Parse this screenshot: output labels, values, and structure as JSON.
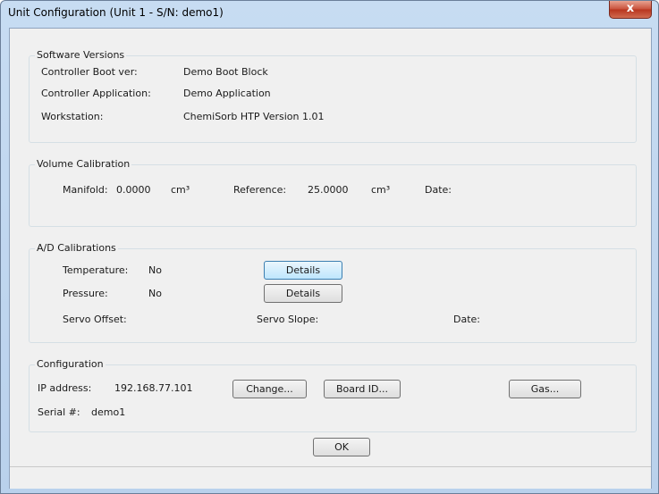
{
  "window": {
    "title": "Unit Configuration (Unit 1 - S/N: demo1)",
    "close_glyph": "x"
  },
  "software": {
    "title": "Software Versions",
    "rows": [
      {
        "label": "Controller Boot ver:",
        "value": "Demo Boot Block"
      },
      {
        "label": "Controller Application:",
        "value": "Demo Application"
      },
      {
        "label": "Workstation:",
        "value": "ChemiSorb HTP Version 1.01"
      }
    ]
  },
  "volume": {
    "title": "Volume Calibration",
    "manifold_label": "Manifold:",
    "manifold_value": "0.0000",
    "manifold_unit": "cm³",
    "reference_label": "Reference:",
    "reference_value": "25.0000",
    "reference_unit": "cm³",
    "date_label": "Date:"
  },
  "ad": {
    "title": "A/D Calibrations",
    "temperature_label": "Temperature:",
    "temperature_value": "No",
    "pressure_label": "Pressure:",
    "pressure_value": "No",
    "details_label": "Details",
    "servo_offset_label": "Servo Offset:",
    "servo_slope_label": "Servo Slope:",
    "date_label": "Date:"
  },
  "config": {
    "title": "Configuration",
    "ip_label": "IP address:",
    "ip_value": "192.168.77.101",
    "change_label": "Change...",
    "board_id_label": "Board ID...",
    "gas_label": "Gas...",
    "serial_label": "Serial #:",
    "serial_value": "demo1"
  },
  "ok_label": "OK"
}
